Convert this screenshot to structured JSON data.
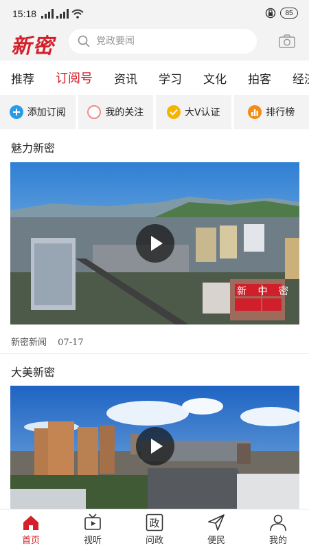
{
  "status_bar": {
    "time": "15:18",
    "battery": "85"
  },
  "header": {
    "logo": "新密",
    "search_placeholder": "党政要闻"
  },
  "tabs": [
    {
      "label": "推荐",
      "active": false
    },
    {
      "label": "订阅号",
      "active": true
    },
    {
      "label": "资讯",
      "active": false
    },
    {
      "label": "学习",
      "active": false
    },
    {
      "label": "文化",
      "active": false
    },
    {
      "label": "拍客",
      "active": false
    },
    {
      "label": "经济",
      "active": false
    }
  ],
  "actions": [
    {
      "label": "添加订阅",
      "icon": "plus-icon",
      "color": "#2a9be6"
    },
    {
      "label": "我的关注",
      "icon": "circle-icon",
      "color": "#f08a8a"
    },
    {
      "label": "大V认证",
      "icon": "check-icon",
      "color": "#f5b400"
    },
    {
      "label": "排行榜",
      "icon": "bar-chart-icon",
      "color": "#f08c1a"
    }
  ],
  "feed": [
    {
      "title": "魅力新密",
      "source": "新密新闻",
      "date": "07-17",
      "watermark": "新 中 密"
    },
    {
      "title": "大美新密"
    }
  ],
  "bottom_nav": [
    {
      "label": "首页",
      "icon": "home-icon",
      "active": true
    },
    {
      "label": "视听",
      "icon": "tv-icon",
      "active": false
    },
    {
      "label": "问政",
      "icon": "zheng-icon",
      "glyph": "政",
      "active": false
    },
    {
      "label": "便民",
      "icon": "send-icon",
      "active": false
    },
    {
      "label": "我的",
      "icon": "user-icon",
      "active": false
    }
  ],
  "colors": {
    "accent": "#d3202a",
    "background": "#f3f3f3"
  }
}
